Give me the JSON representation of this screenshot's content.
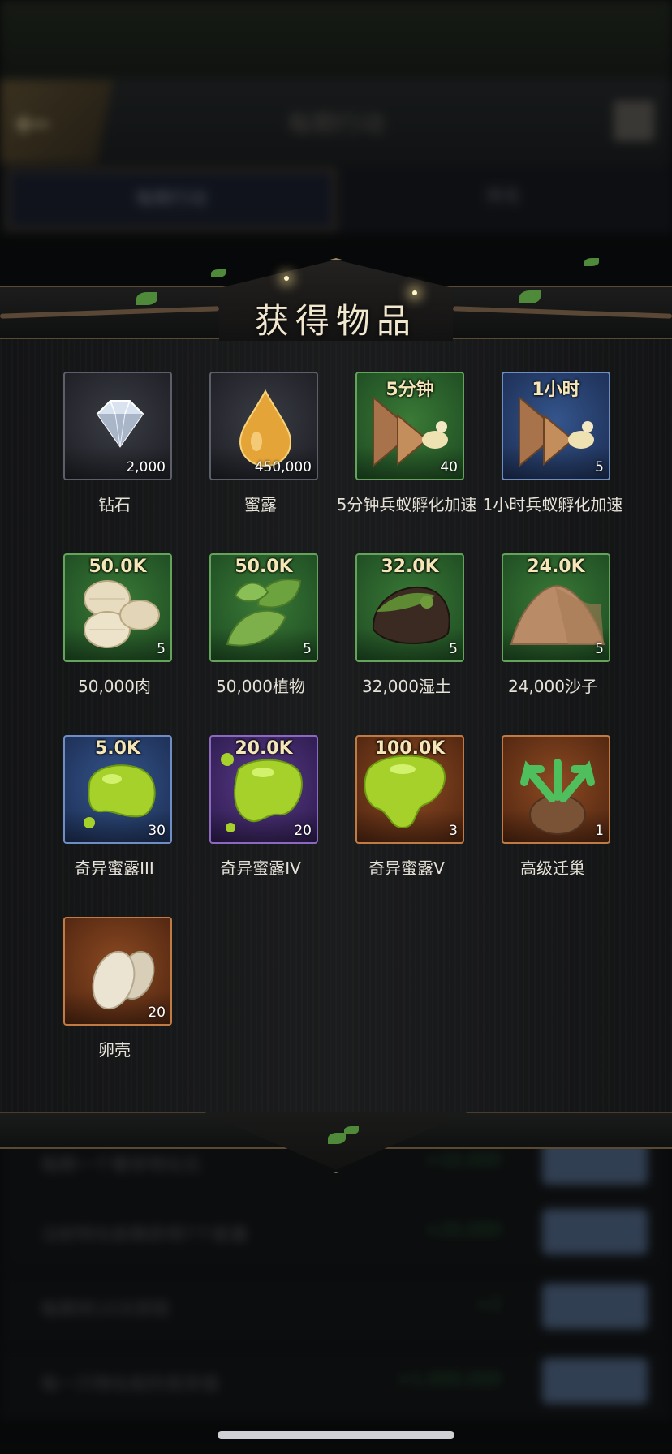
{
  "background": {
    "header_title": "每期行动",
    "tabs": [
      "每期行动",
      "排名"
    ],
    "rows": [
      {
        "text": "每期一个奢侈物化石",
        "value": "+10,000"
      },
      {
        "text": "注射特化蚁粮获得7个能量",
        "value": "+20,000"
      },
      {
        "text": "每期将10次获取",
        "value": "+2"
      },
      {
        "text": "每一只物化蚁的变异值",
        "value": "+1,000,000"
      }
    ]
  },
  "modal": {
    "title": "获得物品",
    "items": [
      {
        "name": "钻石",
        "count": "2,000",
        "top": "",
        "frame": "gray",
        "icon": "diamond-icon"
      },
      {
        "name": "蜜露",
        "count": "450,000",
        "top": "",
        "frame": "gray",
        "icon": "honeydew-drop-icon"
      },
      {
        "name": "5分钟兵蚁孵化加速",
        "count": "40",
        "top": "5分钟",
        "frame": "green",
        "icon": "speedup-icon"
      },
      {
        "name": "1小时兵蚁孵化加速",
        "count": "5",
        "top": "1小时",
        "frame": "blue",
        "icon": "speedup-icon"
      },
      {
        "name": "50,000肉",
        "count": "5",
        "top": "50.0K",
        "frame": "green",
        "icon": "meat-larva-icon"
      },
      {
        "name": "50,000植物",
        "count": "5",
        "top": "50.0K",
        "frame": "green",
        "icon": "plant-leaf-icon"
      },
      {
        "name": "32,000湿土",
        "count": "5",
        "top": "32.0K",
        "frame": "green",
        "icon": "wet-soil-icon"
      },
      {
        "name": "24,000沙子",
        "count": "5",
        "top": "24.0K",
        "frame": "green",
        "icon": "sand-pile-icon"
      },
      {
        "name": "奇异蜜露III",
        "count": "30",
        "top": "5.0K",
        "frame": "blue",
        "icon": "exotic-honeydew-icon"
      },
      {
        "name": "奇异蜜露IV",
        "count": "20",
        "top": "20.0K",
        "frame": "purple",
        "icon": "exotic-honeydew-icon"
      },
      {
        "name": "奇异蜜露V",
        "count": "3",
        "top": "100.0K",
        "frame": "orange",
        "icon": "exotic-honeydew-icon"
      },
      {
        "name": "高级迁巢",
        "count": "1",
        "top": "",
        "frame": "orange",
        "icon": "nest-relocation-icon"
      },
      {
        "name": "卵壳",
        "count": "20",
        "top": "",
        "frame": "orange",
        "icon": "eggshell-icon"
      }
    ]
  }
}
